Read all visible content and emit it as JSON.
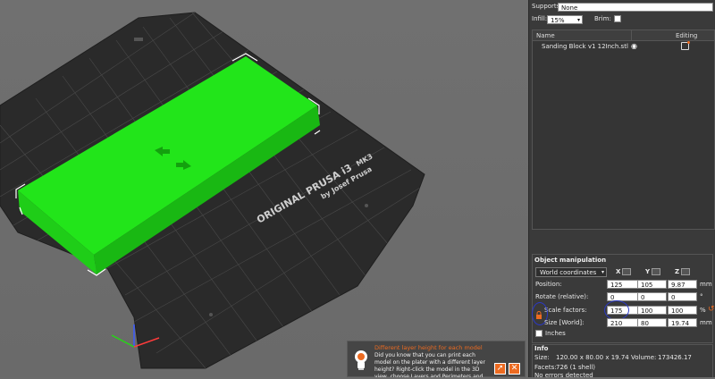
{
  "viewport": {
    "bed_brand": "ORIGINAL PRUSA i3",
    "bed_model": "MK3",
    "bed_author": "by Josef Prusa"
  },
  "panel": {
    "supports_label": "Supports:",
    "supports_value": "None",
    "infill_label": "Infill:",
    "infill_value": "15%",
    "brim_label": "Brim:",
    "list_header_name": "Name",
    "list_header_editing": "Editing",
    "object_name": "Sanding Block v1 12Inch.stl"
  },
  "manipulation": {
    "title": "Object manipulation",
    "coord_system": "World coordinates",
    "axis_x": "X",
    "axis_y": "Y",
    "axis_z": "Z",
    "position_label": "Position:",
    "position": [
      "125",
      "105",
      "9.87"
    ],
    "position_unit": "mm",
    "rotate_label": "Rotate (relative):",
    "rotate": [
      "0",
      "0",
      "0"
    ],
    "rotate_unit": "°",
    "scale_label": "Scale factors:",
    "scale": [
      "175",
      "100",
      "100"
    ],
    "scale_unit": "%",
    "size_label": "Size [World]:",
    "size": [
      "210",
      "80",
      "19.74"
    ],
    "size_unit": "mm",
    "inches_label": "Inches"
  },
  "info": {
    "title": "Info",
    "size_label": "Size:",
    "size_value": "120.00 x 80.00 x 19.74",
    "volume_label": "Volume:",
    "volume_value": "173426.17",
    "facets_label": "Facets:",
    "facets_value": "726 (1 shell)",
    "errors": "No errors detected"
  },
  "tip": {
    "title": "Different layer height for each model",
    "body": "Did you know that you can print each model on the plater with a different layer height? Right-click the model in the 3D view, choose Layers and Perimeters and adjust the values"
  },
  "colors": {
    "accent": "#ed6b21",
    "model": "#22e51a",
    "bed": "#2b2b2b"
  }
}
